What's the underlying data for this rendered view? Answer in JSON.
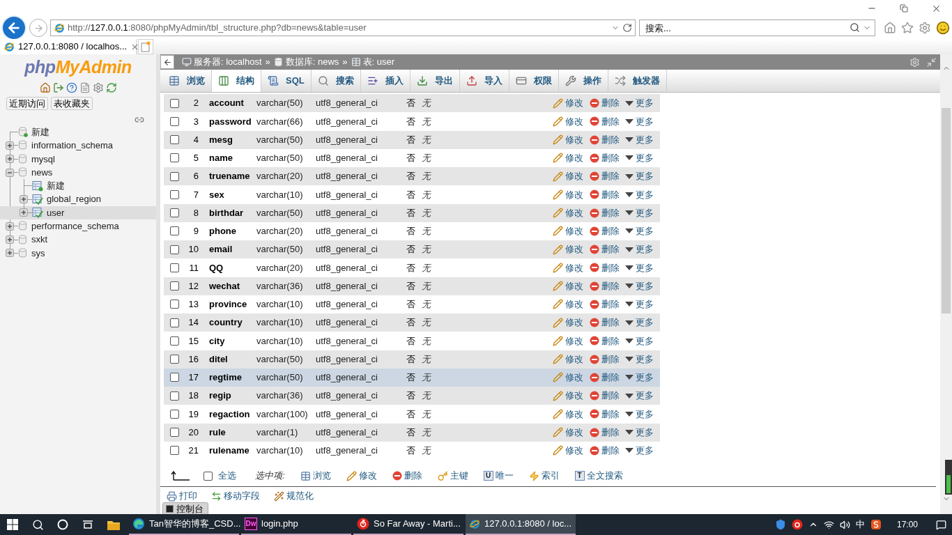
{
  "browser": {
    "address": {
      "scheme": "http://",
      "host": "127.0.0.1",
      "path": ":8080/phpMyAdmin/tbl_structure.php?db=news&table=user"
    },
    "search": {
      "placeholder": "搜索..."
    },
    "tabs": [
      {
        "title": "127.0.0.1:8080 / localhos...",
        "selected": true
      }
    ]
  },
  "sidebar": {
    "logo": {
      "part_1": "php",
      "part_2": "MyAdmin"
    },
    "buttons": [
      "近期访问",
      "表收藏夹"
    ],
    "tree": [
      {
        "label": "新建",
        "kind": "new_database"
      },
      {
        "label": "information_schema",
        "kind": "database",
        "expanded": false
      },
      {
        "label": "mysql",
        "kind": "database",
        "expanded": false
      },
      {
        "label": "news",
        "kind": "database",
        "expanded": true,
        "children": [
          {
            "label": "新建",
            "kind": "new_table"
          },
          {
            "label": "global_region",
            "kind": "table",
            "expanded": false,
            "selected": false
          },
          {
            "label": "user",
            "kind": "table",
            "expanded": false,
            "selected": true
          }
        ]
      },
      {
        "label": "performance_schema",
        "kind": "database",
        "expanded": false
      },
      {
        "label": "sxkt",
        "kind": "database",
        "expanded": false
      },
      {
        "label": "sys",
        "kind": "database",
        "expanded": false
      }
    ]
  },
  "breadcrumb": [
    {
      "kind": "server",
      "label": "服务器: localhost"
    },
    {
      "kind": "separator",
      "label": "»"
    },
    {
      "kind": "database",
      "label": "数据库: news"
    },
    {
      "kind": "separator",
      "label": "»"
    },
    {
      "kind": "table",
      "label": "表: user"
    }
  ],
  "tabs": [
    {
      "kind": "browse",
      "label": "浏览",
      "selected": false
    },
    {
      "kind": "structure",
      "label": "结构",
      "selected": true
    },
    {
      "kind": "sql",
      "label": "SQL",
      "selected": false
    },
    {
      "kind": "search",
      "label": "搜索",
      "selected": false
    },
    {
      "kind": "insert",
      "label": "插入",
      "selected": false
    },
    {
      "kind": "export",
      "label": "导出",
      "selected": false
    },
    {
      "kind": "import",
      "label": "导入",
      "selected": false
    },
    {
      "kind": "privileges",
      "label": "权限",
      "selected": false
    },
    {
      "kind": "operations",
      "label": "操作",
      "selected": false
    },
    {
      "kind": "triggers",
      "label": "触发器",
      "selected": false
    }
  ],
  "table": {
    "rows": [
      {
        "number": "2",
        "name": "account",
        "type": "varchar(50)",
        "collation": "utf8_general_ci",
        "null": "否",
        "default": "无",
        "actions": [
          "修改",
          "删除",
          "更多"
        ],
        "checked": false,
        "highlighted": false
      },
      {
        "number": "3",
        "name": "password",
        "type": "varchar(66)",
        "collation": "utf8_general_ci",
        "null": "否",
        "default": "无",
        "actions": [
          "修改",
          "删除",
          "更多"
        ],
        "checked": false,
        "highlighted": false
      },
      {
        "number": "4",
        "name": "mesg",
        "type": "varchar(50)",
        "collation": "utf8_general_ci",
        "null": "否",
        "default": "无",
        "actions": [
          "修改",
          "删除",
          "更多"
        ],
        "checked": false,
        "highlighted": false
      },
      {
        "number": "5",
        "name": "name",
        "type": "varchar(50)",
        "collation": "utf8_general_ci",
        "null": "否",
        "default": "无",
        "actions": [
          "修改",
          "删除",
          "更多"
        ],
        "checked": false,
        "highlighted": false
      },
      {
        "number": "6",
        "name": "truename",
        "type": "varchar(20)",
        "collation": "utf8_general_ci",
        "null": "否",
        "default": "无",
        "actions": [
          "修改",
          "删除",
          "更多"
        ],
        "checked": false,
        "highlighted": false
      },
      {
        "number": "7",
        "name": "sex",
        "type": "varchar(10)",
        "collation": "utf8_general_ci",
        "null": "否",
        "default": "无",
        "actions": [
          "修改",
          "删除",
          "更多"
        ],
        "checked": false,
        "highlighted": false
      },
      {
        "number": "8",
        "name": "birthdar",
        "type": "varchar(50)",
        "collation": "utf8_general_ci",
        "null": "否",
        "default": "无",
        "actions": [
          "修改",
          "删除",
          "更多"
        ],
        "checked": false,
        "highlighted": false
      },
      {
        "number": "9",
        "name": "phone",
        "type": "varchar(20)",
        "collation": "utf8_general_ci",
        "null": "否",
        "default": "无",
        "actions": [
          "修改",
          "删除",
          "更多"
        ],
        "checked": false,
        "highlighted": false
      },
      {
        "number": "10",
        "name": "email",
        "type": "varchar(50)",
        "collation": "utf8_general_ci",
        "null": "否",
        "default": "无",
        "actions": [
          "修改",
          "删除",
          "更多"
        ],
        "checked": false,
        "highlighted": false
      },
      {
        "number": "11",
        "name": "QQ",
        "type": "varchar(20)",
        "collation": "utf8_general_ci",
        "null": "否",
        "default": "无",
        "actions": [
          "修改",
          "删除",
          "更多"
        ],
        "checked": false,
        "highlighted": false
      },
      {
        "number": "12",
        "name": "wechat",
        "type": "varchar(36)",
        "collation": "utf8_general_ci",
        "null": "否",
        "default": "无",
        "actions": [
          "修改",
          "删除",
          "更多"
        ],
        "checked": false,
        "highlighted": false
      },
      {
        "number": "13",
        "name": "province",
        "type": "varchar(10)",
        "collation": "utf8_general_ci",
        "null": "否",
        "default": "无",
        "actions": [
          "修改",
          "删除",
          "更多"
        ],
        "checked": false,
        "highlighted": false
      },
      {
        "number": "14",
        "name": "country",
        "type": "varchar(10)",
        "collation": "utf8_general_ci",
        "null": "否",
        "default": "无",
        "actions": [
          "修改",
          "删除",
          "更多"
        ],
        "checked": false,
        "highlighted": false
      },
      {
        "number": "15",
        "name": "city",
        "type": "varchar(10)",
        "collation": "utf8_general_ci",
        "null": "否",
        "default": "无",
        "actions": [
          "修改",
          "删除",
          "更多"
        ],
        "checked": false,
        "highlighted": false
      },
      {
        "number": "16",
        "name": "ditel",
        "type": "varchar(50)",
        "collation": "utf8_general_ci",
        "null": "否",
        "default": "无",
        "actions": [
          "修改",
          "删除",
          "更多"
        ],
        "checked": false,
        "highlighted": false
      },
      {
        "number": "17",
        "name": "regtime",
        "type": "varchar(50)",
        "collation": "utf8_general_ci",
        "null": "否",
        "default": "无",
        "actions": [
          "修改",
          "删除",
          "更多"
        ],
        "checked": false,
        "highlighted": true
      },
      {
        "number": "18",
        "name": "regip",
        "type": "varchar(36)",
        "collation": "utf8_general_ci",
        "null": "否",
        "default": "无",
        "actions": [
          "修改",
          "删除",
          "更多"
        ],
        "checked": false,
        "highlighted": false
      },
      {
        "number": "19",
        "name": "regaction",
        "type": "varchar(100)",
        "collation": "utf8_general_ci",
        "null": "否",
        "default": "无",
        "actions": [
          "修改",
          "删除",
          "更多"
        ],
        "checked": false,
        "highlighted": false
      },
      {
        "number": "20",
        "name": "rule",
        "type": "varchar(1)",
        "collation": "utf8_general_ci",
        "null": "否",
        "default": "无",
        "actions": [
          "修改",
          "删除",
          "更多"
        ],
        "checked": false,
        "highlighted": false
      },
      {
        "number": "21",
        "name": "rulename",
        "type": "varchar(10)",
        "collation": "utf8_general_ci",
        "null": "否",
        "default": "无",
        "actions": [
          "修改",
          "删除",
          "更多"
        ],
        "checked": false,
        "highlighted": false
      }
    ]
  },
  "footer": {
    "check_all": {
      "label": "全选",
      "checked": false
    },
    "with_selected": "选中项:",
    "actions": [
      {
        "kind": "browse",
        "label": "浏览"
      },
      {
        "kind": "edit",
        "label": "修改"
      },
      {
        "kind": "delete",
        "label": "删除"
      },
      {
        "kind": "primary",
        "label": "主键"
      },
      {
        "kind": "unique",
        "icon_text": "U",
        "label": "唯一"
      },
      {
        "kind": "index",
        "label": "索引"
      },
      {
        "kind": "fulltext",
        "icon_text": "T",
        "label": "全文搜索"
      }
    ],
    "tools": [
      {
        "kind": "print",
        "label": "打印"
      },
      {
        "kind": "move",
        "label": "移动字段"
      },
      {
        "kind": "normalize",
        "label": "规范化"
      }
    ]
  },
  "console": {
    "label": "控制台"
  },
  "taskbar": {
    "apps": [
      {
        "kind": "edge",
        "label": "Tan智华的博客_CSD...",
        "selected": false
      },
      {
        "kind": "dw",
        "icon_text": "Dw",
        "label": "login.php",
        "selected": false
      },
      {
        "kind": "netease",
        "label": "So Far Away - Marti...",
        "selected": false
      },
      {
        "kind": "ie",
        "label": "127.0.0.1:8080 / loc...",
        "selected": true
      }
    ],
    "tray": {
      "input_method": "中",
      "time": "17:00"
    }
  }
}
